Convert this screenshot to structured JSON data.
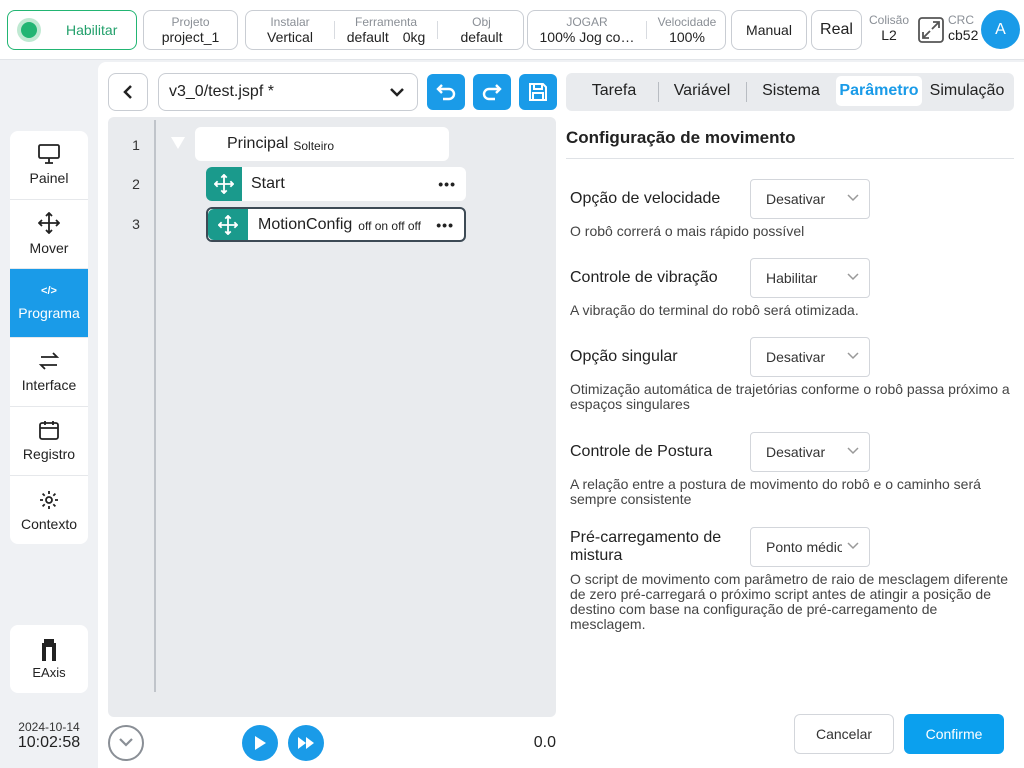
{
  "topbar": {
    "enable_label": "Habilitar",
    "project": {
      "label": "Projeto",
      "value": "project_1"
    },
    "install": {
      "label": "Instalar",
      "value": "Vertical"
    },
    "tool": {
      "label": "Ferramenta",
      "value": "default",
      "weight": "0kg"
    },
    "obj": {
      "label": "Obj",
      "value": "default"
    },
    "jog": {
      "label": "JOGAR",
      "value": "100%  Jog co…"
    },
    "speed": {
      "label": "Velocidade",
      "value": "100%"
    },
    "mode": "Manual",
    "real": "Real",
    "collision": {
      "label": "Colisão",
      "value": "L2"
    },
    "crc": {
      "label": "CRC",
      "value": "cb52"
    },
    "avatar": "A"
  },
  "sidebar": {
    "items": [
      {
        "label": "Painel",
        "icon": "monitor-icon"
      },
      {
        "label": "Mover",
        "icon": "move-icon"
      },
      {
        "label": "Programa",
        "icon": "code-icon",
        "active": true
      },
      {
        "label": "Interface",
        "icon": "swap-icon"
      },
      {
        "label": "Registro",
        "icon": "calendar-icon"
      },
      {
        "label": "Contexto",
        "icon": "gear-icon"
      }
    ],
    "eaxis": "EAxis",
    "date": "2024-10-14",
    "time": "10:02:58"
  },
  "editor": {
    "file": "v3_0/test.jspf *",
    "rows": [
      {
        "num": "1",
        "name": "Principal",
        "sub": "Solteiro"
      },
      {
        "num": "2",
        "name": "Start",
        "sub": ""
      },
      {
        "num": "3",
        "name": "MotionConfig",
        "sub": "off on off off"
      }
    ],
    "progress": "0.0"
  },
  "tabs": [
    "Tarefa",
    "Variável",
    "Sistema",
    "Parâmetro",
    "Simulação"
  ],
  "active_tab": "Parâmetro",
  "panel": {
    "title": "Configuração de movimento",
    "params": [
      {
        "label": "Opção de velocidade",
        "value": "Desativar",
        "desc": "O robô correrá o mais rápido possível"
      },
      {
        "label": "Controle de vibração",
        "value": "Habilitar",
        "desc": "A vibração do terminal do robô será otimizada."
      },
      {
        "label": "Opção singular",
        "value": "Desativar",
        "desc": "Otimização automática de trajetórias conforme o robô passa próximo a espaços singulares"
      },
      {
        "label": "Controle de Postura",
        "value": "Desativar",
        "desc": "A relação entre a postura de movimento do robô e o caminho será sempre consistente"
      },
      {
        "label": "Pré-carregamento de mistura",
        "value": "Ponto médio",
        "desc": "O script de movimento com parâmetro de raio de mesclagem diferente de zero pré-carregará o próximo script antes de atingir a posição de destino com base na configuração de pré-carregamento de mesclagem."
      }
    ],
    "cancel": "Cancelar",
    "confirm": "Confirme"
  },
  "colors": {
    "accent": "#1a9be8",
    "teal": "#1a9a8c",
    "enable_green": "#22b573"
  }
}
